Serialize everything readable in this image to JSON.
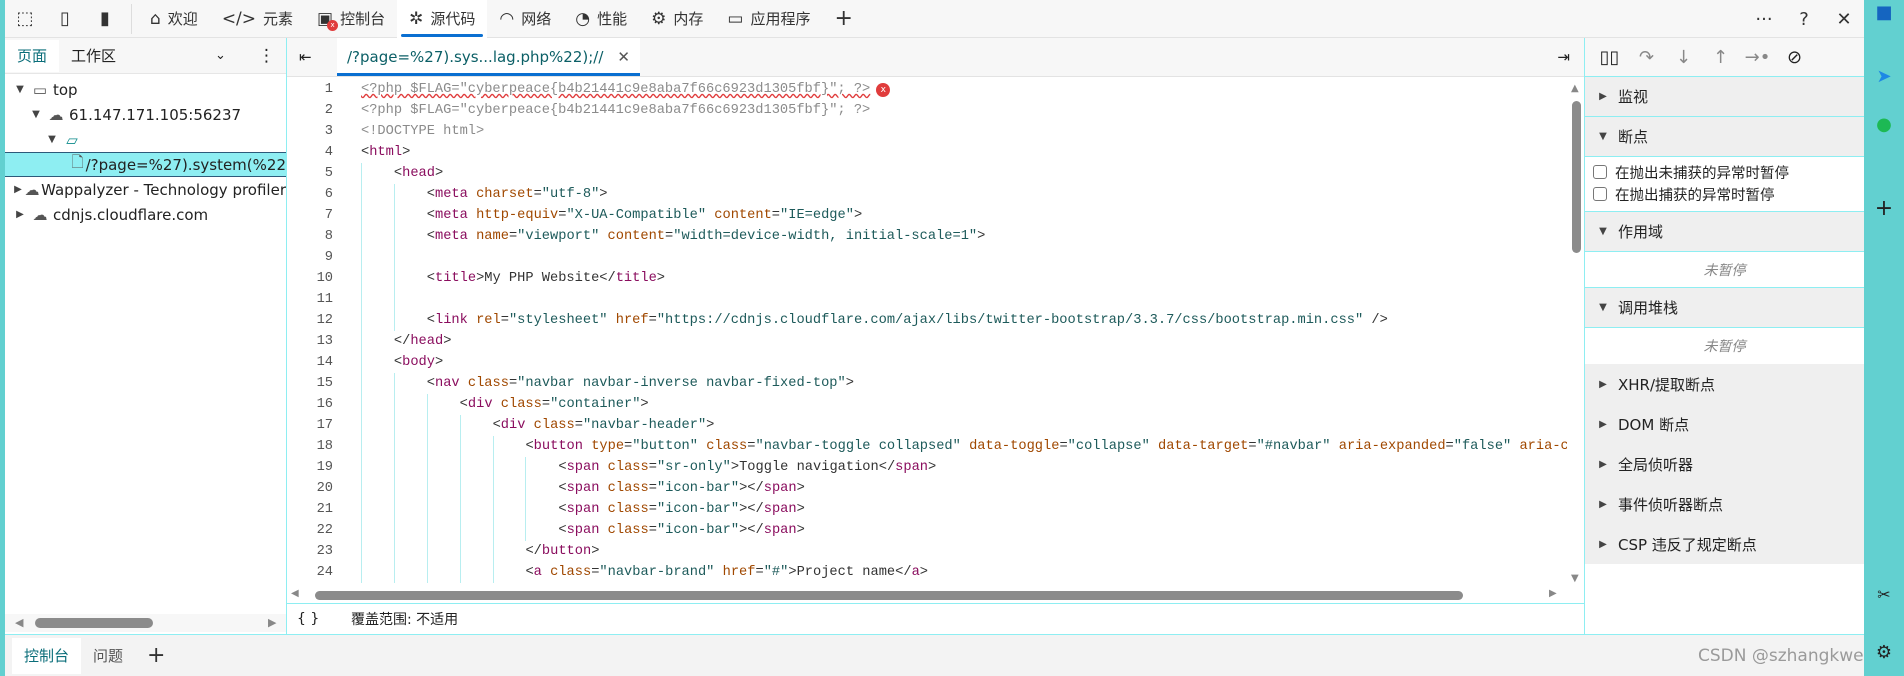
{
  "toolbar": {
    "tabs": [
      {
        "label": "欢迎",
        "icon": "home-icon",
        "glyph": "⌂"
      },
      {
        "label": "元素",
        "icon": "code-tag-icon",
        "glyph": "</>"
      },
      {
        "label": "控制台",
        "icon": "console-icon",
        "glyph": "▣"
      },
      {
        "label": "源代码",
        "icon": "bug-icon",
        "glyph": "✲",
        "active": true
      },
      {
        "label": "网络",
        "icon": "wifi-icon",
        "glyph": "◠"
      },
      {
        "label": "性能",
        "icon": "gauge-icon",
        "glyph": "◔"
      },
      {
        "label": "内存",
        "icon": "chip-icon",
        "glyph": "⚙"
      },
      {
        "label": "应用程序",
        "icon": "app-window-icon",
        "glyph": "▭"
      }
    ],
    "add": "+",
    "more": "···",
    "help": "?",
    "close": "✕",
    "console_error_badge": "x"
  },
  "left_panel": {
    "tabs": [
      "页面",
      "工作区"
    ],
    "tree": [
      {
        "label": "top",
        "icon": "frame-icon",
        "expanded": true,
        "depth": 0
      },
      {
        "label": "61.147.171.105:56237",
        "icon": "cloud-icon",
        "expanded": true,
        "depth": 1
      },
      {
        "label": "",
        "icon": "folder-icon",
        "expanded": true,
        "depth": 2
      },
      {
        "label": "/?page=%27).system(%22",
        "icon": "file-icon",
        "depth": 3,
        "selected": true
      },
      {
        "label": "Wappalyzer - Technology profiler",
        "icon": "cloud-icon",
        "expanded": false,
        "depth": 0
      },
      {
        "label": "cdnjs.cloudflare.com",
        "icon": "cloud-icon",
        "expanded": false,
        "depth": 0
      }
    ]
  },
  "editor": {
    "tab_label": "/?page=%27).sys...lag.php%22);//",
    "lines": [
      {
        "indent": 0,
        "error": true,
        "tokens": [
          [
            "g",
            "<?php $FLAG=\"cyberpeace{b4b21441c9e8aba7f66c6923d1305fbf}\"; ?>"
          ]
        ]
      },
      {
        "indent": 0,
        "tokens": [
          [
            "g",
            "<?php $FLAG=\"cyberpeace{b4b21441c9e8aba7f66c6923d1305fbf}\"; ?>"
          ]
        ]
      },
      {
        "indent": 0,
        "tokens": [
          [
            "g",
            "<!DOCTYPE html>"
          ]
        ]
      },
      {
        "indent": 0,
        "tokens": [
          [
            "p",
            "<"
          ],
          [
            "t",
            "html"
          ],
          [
            "p",
            ">"
          ]
        ]
      },
      {
        "indent": 1,
        "tokens": [
          [
            "p",
            "<"
          ],
          [
            "t",
            "head"
          ],
          [
            "p",
            ">"
          ]
        ]
      },
      {
        "indent": 2,
        "tokens": [
          [
            "p",
            "<"
          ],
          [
            "t",
            "meta"
          ],
          [
            "p",
            " "
          ],
          [
            "a",
            "charset"
          ],
          [
            "p",
            "="
          ],
          [
            "v",
            "\"utf-8\""
          ],
          [
            "p",
            ">"
          ]
        ]
      },
      {
        "indent": 2,
        "tokens": [
          [
            "p",
            "<"
          ],
          [
            "t",
            "meta"
          ],
          [
            "p",
            " "
          ],
          [
            "a",
            "http-equiv"
          ],
          [
            "p",
            "="
          ],
          [
            "v",
            "\"X-UA-Compatible\""
          ],
          [
            "p",
            " "
          ],
          [
            "a",
            "content"
          ],
          [
            "p",
            "="
          ],
          [
            "v",
            "\"IE=edge\""
          ],
          [
            "p",
            ">"
          ]
        ]
      },
      {
        "indent": 2,
        "tokens": [
          [
            "p",
            "<"
          ],
          [
            "t",
            "meta"
          ],
          [
            "p",
            " "
          ],
          [
            "a",
            "name"
          ],
          [
            "p",
            "="
          ],
          [
            "v",
            "\"viewport\""
          ],
          [
            "p",
            " "
          ],
          [
            "a",
            "content"
          ],
          [
            "p",
            "="
          ],
          [
            "v",
            "\"width=device-width, initial-scale=1\""
          ],
          [
            "p",
            ">"
          ]
        ]
      },
      {
        "indent": 2,
        "tokens": []
      },
      {
        "indent": 2,
        "tokens": [
          [
            "p",
            "<"
          ],
          [
            "t",
            "title"
          ],
          [
            "p",
            ">My PHP Website</"
          ],
          [
            "t",
            "title"
          ],
          [
            "p",
            ">"
          ]
        ]
      },
      {
        "indent": 2,
        "tokens": []
      },
      {
        "indent": 2,
        "tokens": [
          [
            "p",
            "<"
          ],
          [
            "t",
            "link"
          ],
          [
            "p",
            " "
          ],
          [
            "a",
            "rel"
          ],
          [
            "p",
            "="
          ],
          [
            "v",
            "\"stylesheet\""
          ],
          [
            "p",
            " "
          ],
          [
            "a",
            "href"
          ],
          [
            "p",
            "="
          ],
          [
            "v",
            "\"https://cdnjs.cloudflare.com/ajax/libs/twitter-bootstrap/3.3.7/css/bootstrap.min.css\""
          ],
          [
            "p",
            " />"
          ]
        ]
      },
      {
        "indent": 1,
        "tokens": [
          [
            "p",
            "</"
          ],
          [
            "t",
            "head"
          ],
          [
            "p",
            ">"
          ]
        ]
      },
      {
        "indent": 1,
        "tokens": [
          [
            "p",
            "<"
          ],
          [
            "t",
            "body"
          ],
          [
            "p",
            ">"
          ]
        ]
      },
      {
        "indent": 2,
        "tokens": [
          [
            "p",
            "<"
          ],
          [
            "t",
            "nav"
          ],
          [
            "p",
            " "
          ],
          [
            "a",
            "class"
          ],
          [
            "p",
            "="
          ],
          [
            "v",
            "\"navbar navbar-inverse navbar-fixed-top\""
          ],
          [
            "p",
            ">"
          ]
        ]
      },
      {
        "indent": 3,
        "tokens": [
          [
            "p",
            "<"
          ],
          [
            "t",
            "div"
          ],
          [
            "p",
            " "
          ],
          [
            "a",
            "class"
          ],
          [
            "p",
            "="
          ],
          [
            "v",
            "\"container\""
          ],
          [
            "p",
            ">"
          ]
        ]
      },
      {
        "indent": 4,
        "tokens": [
          [
            "p",
            "<"
          ],
          [
            "t",
            "div"
          ],
          [
            "p",
            " "
          ],
          [
            "a",
            "class"
          ],
          [
            "p",
            "="
          ],
          [
            "v",
            "\"navbar-header\""
          ],
          [
            "p",
            ">"
          ]
        ]
      },
      {
        "indent": 5,
        "tokens": [
          [
            "p",
            "<"
          ],
          [
            "t",
            "button"
          ],
          [
            "p",
            " "
          ],
          [
            "a",
            "type"
          ],
          [
            "p",
            "="
          ],
          [
            "v",
            "\"button\""
          ],
          [
            "p",
            " "
          ],
          [
            "a",
            "class"
          ],
          [
            "p",
            "="
          ],
          [
            "v",
            "\"navbar-toggle collapsed\""
          ],
          [
            "p",
            " "
          ],
          [
            "a",
            "data-toggle"
          ],
          [
            "p",
            "="
          ],
          [
            "v",
            "\"collapse\""
          ],
          [
            "p",
            " "
          ],
          [
            "a",
            "data-target"
          ],
          [
            "p",
            "="
          ],
          [
            "v",
            "\"#navbar\""
          ],
          [
            "p",
            " "
          ],
          [
            "a",
            "aria-expanded"
          ],
          [
            "p",
            "="
          ],
          [
            "v",
            "\"false\""
          ],
          [
            "p",
            " "
          ],
          [
            "a",
            "aria-contr"
          ]
        ]
      },
      {
        "indent": 6,
        "tokens": [
          [
            "p",
            "<"
          ],
          [
            "t",
            "span"
          ],
          [
            "p",
            " "
          ],
          [
            "a",
            "class"
          ],
          [
            "p",
            "="
          ],
          [
            "v",
            "\"sr-only\""
          ],
          [
            "p",
            ">Toggle navigation</"
          ],
          [
            "t",
            "span"
          ],
          [
            "p",
            ">"
          ]
        ]
      },
      {
        "indent": 6,
        "tokens": [
          [
            "p",
            "<"
          ],
          [
            "t",
            "span"
          ],
          [
            "p",
            " "
          ],
          [
            "a",
            "class"
          ],
          [
            "p",
            "="
          ],
          [
            "v",
            "\"icon-bar\""
          ],
          [
            "p",
            "></"
          ],
          [
            "t",
            "span"
          ],
          [
            "p",
            ">"
          ]
        ]
      },
      {
        "indent": 6,
        "tokens": [
          [
            "p",
            "<"
          ],
          [
            "t",
            "span"
          ],
          [
            "p",
            " "
          ],
          [
            "a",
            "class"
          ],
          [
            "p",
            "="
          ],
          [
            "v",
            "\"icon-bar\""
          ],
          [
            "p",
            "></"
          ],
          [
            "t",
            "span"
          ],
          [
            "p",
            ">"
          ]
        ]
      },
      {
        "indent": 6,
        "tokens": [
          [
            "p",
            "<"
          ],
          [
            "t",
            "span"
          ],
          [
            "p",
            " "
          ],
          [
            "a",
            "class"
          ],
          [
            "p",
            "="
          ],
          [
            "v",
            "\"icon-bar\""
          ],
          [
            "p",
            "></"
          ],
          [
            "t",
            "span"
          ],
          [
            "p",
            ">"
          ]
        ]
      },
      {
        "indent": 5,
        "tokens": [
          [
            "p",
            "</"
          ],
          [
            "t",
            "button"
          ],
          [
            "p",
            ">"
          ]
        ]
      },
      {
        "indent": 5,
        "tokens": [
          [
            "p",
            "<"
          ],
          [
            "t",
            "a"
          ],
          [
            "p",
            " "
          ],
          [
            "a",
            "class"
          ],
          [
            "p",
            "="
          ],
          [
            "v",
            "\"navbar-brand\""
          ],
          [
            "p",
            " "
          ],
          [
            "a",
            "href"
          ],
          [
            "p",
            "="
          ],
          [
            "v",
            "\"#\""
          ],
          [
            "p",
            ">Project name</"
          ],
          [
            "t",
            "a"
          ],
          [
            "p",
            ">"
          ]
        ]
      }
    ],
    "status_braces": "{ }",
    "status_text": "覆盖范围: 不适用"
  },
  "debugger": {
    "controls": [
      {
        "icon": "pause-icon",
        "glyph": "▯▯"
      },
      {
        "icon": "step-over-icon",
        "glyph": "↷"
      },
      {
        "icon": "step-into-icon",
        "glyph": "↓"
      },
      {
        "icon": "step-out-icon",
        "glyph": "↑"
      },
      {
        "icon": "step-icon",
        "glyph": "→•"
      },
      {
        "icon": "deactivate-breakpoints-icon",
        "glyph": "⊘"
      }
    ],
    "watch": "监视",
    "breakpoints": "断点",
    "checkboxes": [
      {
        "label": "在抛出未捕获的异常时暂停",
        "checked": false
      },
      {
        "label": "在抛出捕获的异常时暂停",
        "checked": false
      }
    ],
    "scope": "作用域",
    "not_paused": "未暂停",
    "call_stack": "调用堆栈",
    "collapsed_sections": [
      "XHR/提取断点",
      "DOM 断点",
      "全局侦听器",
      "事件侦听器断点",
      "CSP 违反了规定断点"
    ]
  },
  "drawer": {
    "tabs": [
      "控制台",
      "问题"
    ],
    "add": "+"
  },
  "watermark": "CSDN @szhangkwenya",
  "colors": {
    "accent": "#0a6fd1",
    "selection": "#8eeef2",
    "edge_bar": "#62d0d0",
    "error": "#e03c3c"
  }
}
